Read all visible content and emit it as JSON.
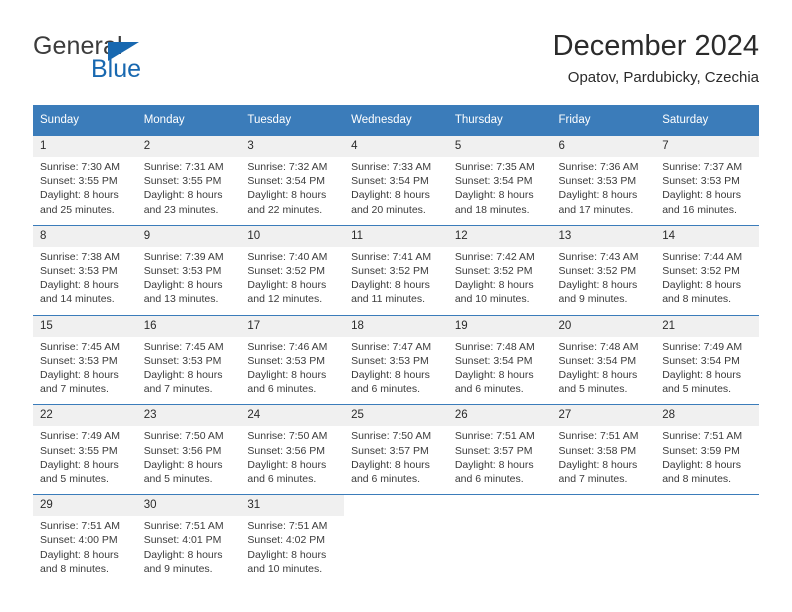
{
  "brand": {
    "name_part1": "General",
    "name_part2": "Blue",
    "triangle_color": "#1868b0"
  },
  "header": {
    "title": "December 2024",
    "subtitle": "Opatov, Pardubicky, Czechia"
  },
  "theme": {
    "header_bg": "#3b7cba",
    "daynum_bg": "#f0f0f0",
    "divider": "#3b7cba",
    "text": "#3b3b3b"
  },
  "weekday_headers": [
    "Sunday",
    "Monday",
    "Tuesday",
    "Wednesday",
    "Thursday",
    "Friday",
    "Saturday"
  ],
  "weeks": [
    [
      {
        "day": "1",
        "sunrise": "Sunrise: 7:30 AM",
        "sunset": "Sunset: 3:55 PM",
        "daylight_line1": "Daylight: 8 hours",
        "daylight_line2": "and 25 minutes."
      },
      {
        "day": "2",
        "sunrise": "Sunrise: 7:31 AM",
        "sunset": "Sunset: 3:55 PM",
        "daylight_line1": "Daylight: 8 hours",
        "daylight_line2": "and 23 minutes."
      },
      {
        "day": "3",
        "sunrise": "Sunrise: 7:32 AM",
        "sunset": "Sunset: 3:54 PM",
        "daylight_line1": "Daylight: 8 hours",
        "daylight_line2": "and 22 minutes."
      },
      {
        "day": "4",
        "sunrise": "Sunrise: 7:33 AM",
        "sunset": "Sunset: 3:54 PM",
        "daylight_line1": "Daylight: 8 hours",
        "daylight_line2": "and 20 minutes."
      },
      {
        "day": "5",
        "sunrise": "Sunrise: 7:35 AM",
        "sunset": "Sunset: 3:54 PM",
        "daylight_line1": "Daylight: 8 hours",
        "daylight_line2": "and 18 minutes."
      },
      {
        "day": "6",
        "sunrise": "Sunrise: 7:36 AM",
        "sunset": "Sunset: 3:53 PM",
        "daylight_line1": "Daylight: 8 hours",
        "daylight_line2": "and 17 minutes."
      },
      {
        "day": "7",
        "sunrise": "Sunrise: 7:37 AM",
        "sunset": "Sunset: 3:53 PM",
        "daylight_line1": "Daylight: 8 hours",
        "daylight_line2": "and 16 minutes."
      }
    ],
    [
      {
        "day": "8",
        "sunrise": "Sunrise: 7:38 AM",
        "sunset": "Sunset: 3:53 PM",
        "daylight_line1": "Daylight: 8 hours",
        "daylight_line2": "and 14 minutes."
      },
      {
        "day": "9",
        "sunrise": "Sunrise: 7:39 AM",
        "sunset": "Sunset: 3:53 PM",
        "daylight_line1": "Daylight: 8 hours",
        "daylight_line2": "and 13 minutes."
      },
      {
        "day": "10",
        "sunrise": "Sunrise: 7:40 AM",
        "sunset": "Sunset: 3:52 PM",
        "daylight_line1": "Daylight: 8 hours",
        "daylight_line2": "and 12 minutes."
      },
      {
        "day": "11",
        "sunrise": "Sunrise: 7:41 AM",
        "sunset": "Sunset: 3:52 PM",
        "daylight_line1": "Daylight: 8 hours",
        "daylight_line2": "and 11 minutes."
      },
      {
        "day": "12",
        "sunrise": "Sunrise: 7:42 AM",
        "sunset": "Sunset: 3:52 PM",
        "daylight_line1": "Daylight: 8 hours",
        "daylight_line2": "and 10 minutes."
      },
      {
        "day": "13",
        "sunrise": "Sunrise: 7:43 AM",
        "sunset": "Sunset: 3:52 PM",
        "daylight_line1": "Daylight: 8 hours",
        "daylight_line2": "and 9 minutes."
      },
      {
        "day": "14",
        "sunrise": "Sunrise: 7:44 AM",
        "sunset": "Sunset: 3:52 PM",
        "daylight_line1": "Daylight: 8 hours",
        "daylight_line2": "and 8 minutes."
      }
    ],
    [
      {
        "day": "15",
        "sunrise": "Sunrise: 7:45 AM",
        "sunset": "Sunset: 3:53 PM",
        "daylight_line1": "Daylight: 8 hours",
        "daylight_line2": "and 7 minutes."
      },
      {
        "day": "16",
        "sunrise": "Sunrise: 7:45 AM",
        "sunset": "Sunset: 3:53 PM",
        "daylight_line1": "Daylight: 8 hours",
        "daylight_line2": "and 7 minutes."
      },
      {
        "day": "17",
        "sunrise": "Sunrise: 7:46 AM",
        "sunset": "Sunset: 3:53 PM",
        "daylight_line1": "Daylight: 8 hours",
        "daylight_line2": "and 6 minutes."
      },
      {
        "day": "18",
        "sunrise": "Sunrise: 7:47 AM",
        "sunset": "Sunset: 3:53 PM",
        "daylight_line1": "Daylight: 8 hours",
        "daylight_line2": "and 6 minutes."
      },
      {
        "day": "19",
        "sunrise": "Sunrise: 7:48 AM",
        "sunset": "Sunset: 3:54 PM",
        "daylight_line1": "Daylight: 8 hours",
        "daylight_line2": "and 6 minutes."
      },
      {
        "day": "20",
        "sunrise": "Sunrise: 7:48 AM",
        "sunset": "Sunset: 3:54 PM",
        "daylight_line1": "Daylight: 8 hours",
        "daylight_line2": "and 5 minutes."
      },
      {
        "day": "21",
        "sunrise": "Sunrise: 7:49 AM",
        "sunset": "Sunset: 3:54 PM",
        "daylight_line1": "Daylight: 8 hours",
        "daylight_line2": "and 5 minutes."
      }
    ],
    [
      {
        "day": "22",
        "sunrise": "Sunrise: 7:49 AM",
        "sunset": "Sunset: 3:55 PM",
        "daylight_line1": "Daylight: 8 hours",
        "daylight_line2": "and 5 minutes."
      },
      {
        "day": "23",
        "sunrise": "Sunrise: 7:50 AM",
        "sunset": "Sunset: 3:56 PM",
        "daylight_line1": "Daylight: 8 hours",
        "daylight_line2": "and 5 minutes."
      },
      {
        "day": "24",
        "sunrise": "Sunrise: 7:50 AM",
        "sunset": "Sunset: 3:56 PM",
        "daylight_line1": "Daylight: 8 hours",
        "daylight_line2": "and 6 minutes."
      },
      {
        "day": "25",
        "sunrise": "Sunrise: 7:50 AM",
        "sunset": "Sunset: 3:57 PM",
        "daylight_line1": "Daylight: 8 hours",
        "daylight_line2": "and 6 minutes."
      },
      {
        "day": "26",
        "sunrise": "Sunrise: 7:51 AM",
        "sunset": "Sunset: 3:57 PM",
        "daylight_line1": "Daylight: 8 hours",
        "daylight_line2": "and 6 minutes."
      },
      {
        "day": "27",
        "sunrise": "Sunrise: 7:51 AM",
        "sunset": "Sunset: 3:58 PM",
        "daylight_line1": "Daylight: 8 hours",
        "daylight_line2": "and 7 minutes."
      },
      {
        "day": "28",
        "sunrise": "Sunrise: 7:51 AM",
        "sunset": "Sunset: 3:59 PM",
        "daylight_line1": "Daylight: 8 hours",
        "daylight_line2": "and 8 minutes."
      }
    ],
    [
      {
        "day": "29",
        "sunrise": "Sunrise: 7:51 AM",
        "sunset": "Sunset: 4:00 PM",
        "daylight_line1": "Daylight: 8 hours",
        "daylight_line2": "and 8 minutes."
      },
      {
        "day": "30",
        "sunrise": "Sunrise: 7:51 AM",
        "sunset": "Sunset: 4:01 PM",
        "daylight_line1": "Daylight: 8 hours",
        "daylight_line2": "and 9 minutes."
      },
      {
        "day": "31",
        "sunrise": "Sunrise: 7:51 AM",
        "sunset": "Sunset: 4:02 PM",
        "daylight_line1": "Daylight: 8 hours",
        "daylight_line2": "and 10 minutes."
      },
      {
        "day": "",
        "sunrise": "",
        "sunset": "",
        "daylight_line1": "",
        "daylight_line2": ""
      },
      {
        "day": "",
        "sunrise": "",
        "sunset": "",
        "daylight_line1": "",
        "daylight_line2": ""
      },
      {
        "day": "",
        "sunrise": "",
        "sunset": "",
        "daylight_line1": "",
        "daylight_line2": ""
      },
      {
        "day": "",
        "sunrise": "",
        "sunset": "",
        "daylight_line1": "",
        "daylight_line2": ""
      }
    ]
  ]
}
